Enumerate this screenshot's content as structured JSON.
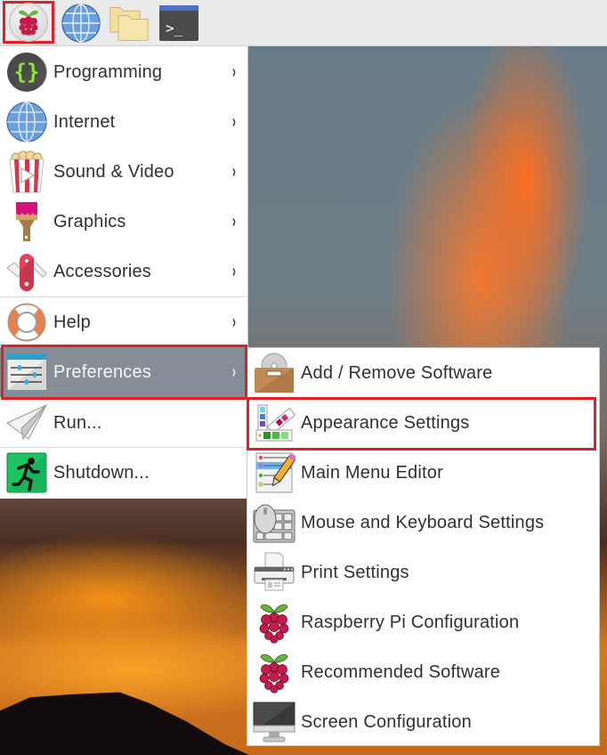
{
  "taskbar": {
    "items": [
      {
        "name": "menu-button",
        "icon": "raspberry-icon"
      },
      {
        "name": "web-browser-launcher",
        "icon": "globe-icon"
      },
      {
        "name": "file-manager-launcher",
        "icon": "folder-icon"
      },
      {
        "name": "terminal-launcher",
        "icon": "terminal-icon",
        "glyph": ">_"
      }
    ]
  },
  "main_menu": {
    "items": [
      {
        "label": "Programming",
        "icon": "braces-icon",
        "has_submenu": true
      },
      {
        "label": "Internet",
        "icon": "globe-icon",
        "has_submenu": true
      },
      {
        "label": "Sound & Video",
        "icon": "popcorn-video-icon",
        "has_submenu": true
      },
      {
        "label": "Graphics",
        "icon": "paintbrush-icon",
        "has_submenu": true
      },
      {
        "label": "Accessories",
        "icon": "pocket-knife-icon",
        "has_submenu": true
      },
      {
        "label": "Help",
        "icon": "lifebuoy-icon",
        "has_submenu": true
      },
      {
        "label": "Preferences",
        "icon": "sliders-window-icon",
        "has_submenu": true,
        "active": true
      },
      {
        "label": "Run...",
        "icon": "paper-plane-icon",
        "has_submenu": false
      },
      {
        "label": "Shutdown...",
        "icon": "running-man-exit-icon",
        "has_submenu": false
      }
    ],
    "arrow_glyph": "›"
  },
  "preferences_submenu": {
    "items": [
      {
        "label": "Add / Remove Software",
        "icon": "package-disc-icon"
      },
      {
        "label": "Appearance Settings",
        "icon": "color-swatches-icon"
      },
      {
        "label": "Main Menu Editor",
        "icon": "list-pencil-icon"
      },
      {
        "label": "Mouse and Keyboard Settings",
        "icon": "mouse-keyboard-icon"
      },
      {
        "label": "Print Settings",
        "icon": "printer-icon"
      },
      {
        "label": "Raspberry Pi Configuration",
        "icon": "raspberry-icon"
      },
      {
        "label": "Recommended Software",
        "icon": "raspberry-icon"
      },
      {
        "label": "Screen Configuration",
        "icon": "monitor-icon"
      }
    ]
  },
  "colors": {
    "highlight_outline": "#e41e26",
    "active_item_bg": "#858e96",
    "taskbar_bg": "#ebebeb",
    "menu_bg": "#ffffff",
    "text": "#303030"
  }
}
